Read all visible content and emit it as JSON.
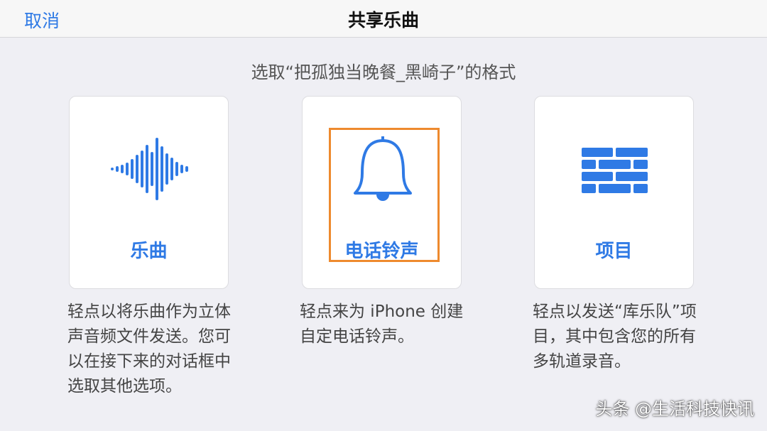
{
  "navbar": {
    "cancel_label": "取消",
    "title": "共享乐曲"
  },
  "subtitle": "选取“把孤独当晚餐_黑崎子”的格式",
  "options": [
    {
      "label": "乐曲",
      "icon": "waveform-icon",
      "description": "轻点以将乐曲作为立体声音频文件发送。您可以在接下来的对话框中选取其他选项。"
    },
    {
      "label": "电话铃声",
      "icon": "bell-icon",
      "description": "轻点来为 iPhone 创建自定电话铃声。",
      "highlighted": true
    },
    {
      "label": "项目",
      "icon": "brick-wall-icon",
      "description": "轻点以发送“库乐队”项目，其中包含您的所有多轨道录音。"
    }
  ],
  "watermark": "头条 @生活科技快讯",
  "colors": {
    "accent": "#2f7ae5",
    "highlight": "#ee8a2e",
    "background": "#efeff4"
  }
}
